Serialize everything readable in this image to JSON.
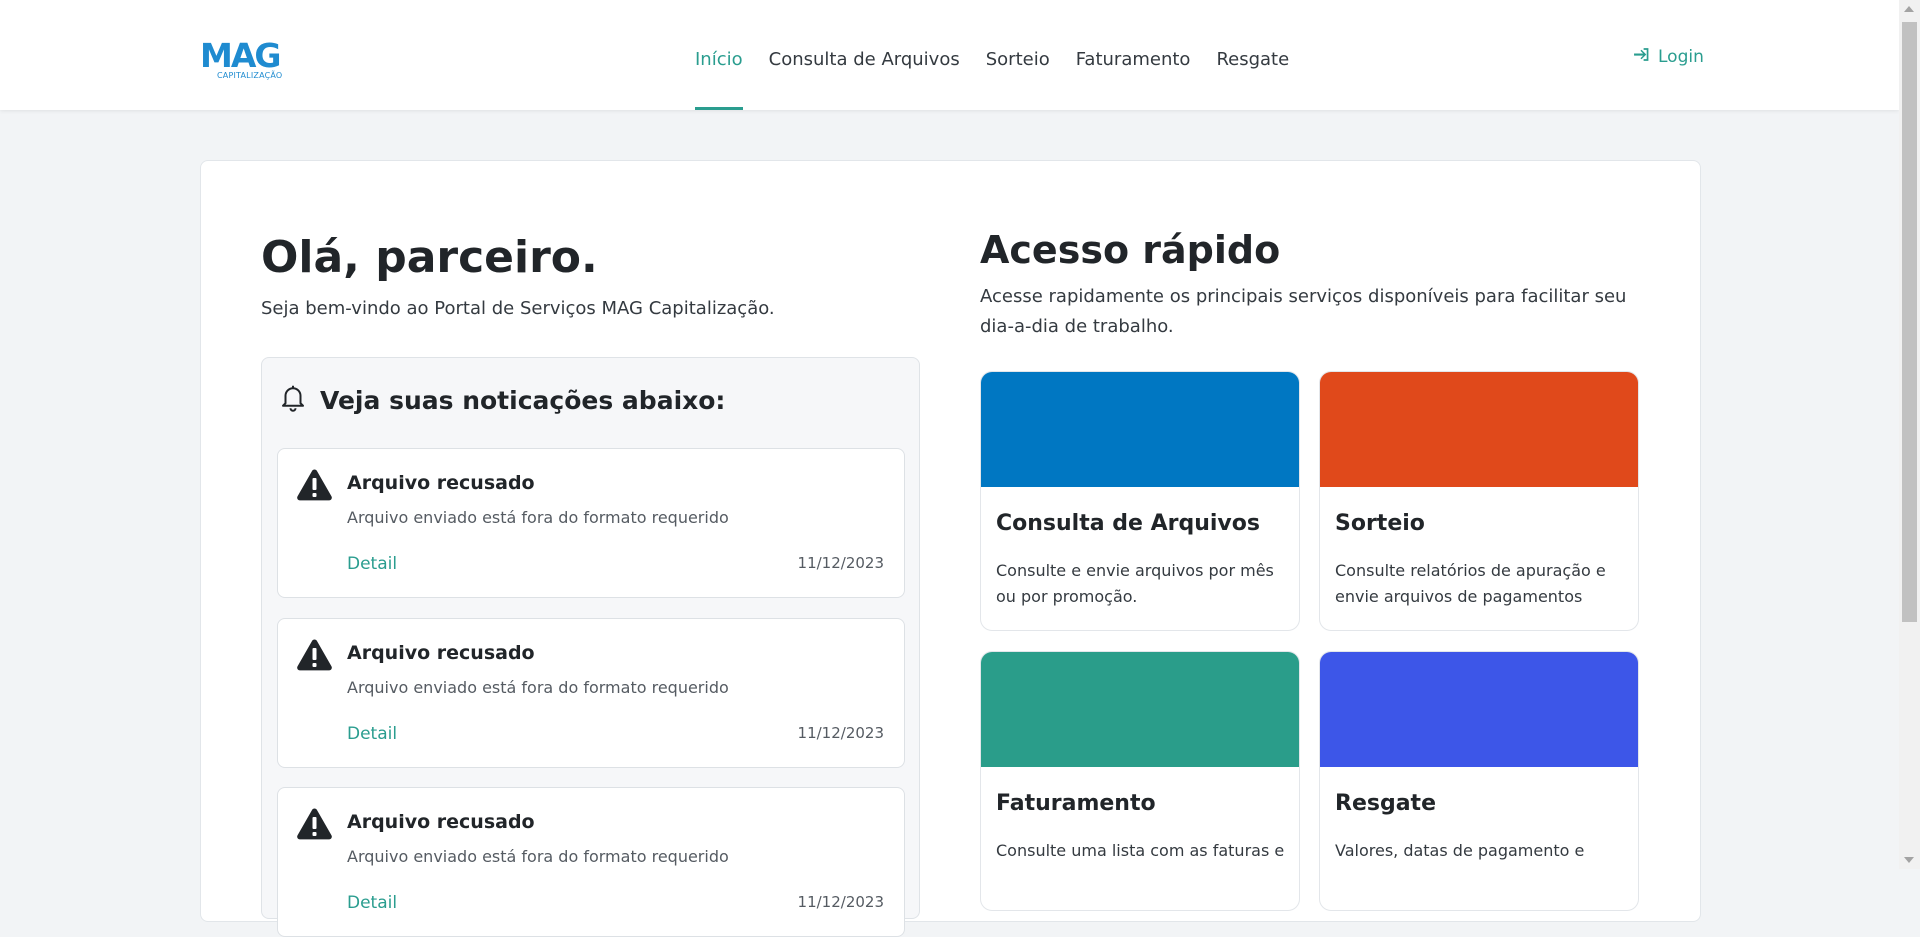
{
  "brand": {
    "name": "MAG",
    "subtitle": "CAPITALIZAÇÃO",
    "color": "#1f8bd0"
  },
  "nav": {
    "items": [
      {
        "label": "Início",
        "active": true
      },
      {
        "label": "Consulta de Arquivos",
        "active": false
      },
      {
        "label": "Sorteio",
        "active": false
      },
      {
        "label": "Faturamento",
        "active": false
      },
      {
        "label": "Resgate",
        "active": false
      }
    ],
    "login_label": "Login",
    "login_icon": "sign-in-icon"
  },
  "colors": {
    "accent": "#2a9d8f"
  },
  "greeting": {
    "title": "Olá, parceiro.",
    "subtitle": "Seja bem-vindo ao Portal de Serviços MAG Capitalização."
  },
  "notifications": {
    "heading": "Veja suas noticações abaixo:",
    "heading_icon": "bell-icon",
    "items": [
      {
        "icon": "warning-icon",
        "title": "Arquivo recusado",
        "description": "Arquivo enviado está fora do formato requerido",
        "link": "Detail",
        "date": "11/12/2023"
      },
      {
        "icon": "warning-icon",
        "title": "Arquivo recusado",
        "description": "Arquivo enviado está fora do formato requerido",
        "link": "Detail",
        "date": "11/12/2023"
      },
      {
        "icon": "warning-icon",
        "title": "Arquivo recusado",
        "description": "Arquivo enviado está fora do formato requerido",
        "link": "Detail",
        "date": "11/12/2023"
      }
    ]
  },
  "quick_access": {
    "title": "Acesso rápido",
    "description": "Acesse rapidamente os principais serviços disponíveis para facilitar seu dia-a-dia de trabalho.",
    "cards": [
      {
        "title": "Consulta de Arquivos",
        "text": "Consulte e envie arquivos por mês ou por promoção.",
        "color": "#0077c2"
      },
      {
        "title": "Sorteio",
        "text": "Consulte relatórios de apuração e envie arquivos de pagamentos",
        "color": "#e0491b"
      },
      {
        "title": "Faturamento",
        "text": "Consulte uma lista com as faturas e",
        "color": "#2a9d8a"
      },
      {
        "title": "Resgate",
        "text": "Valores, datas de pagamento e",
        "color": "#3d56e8"
      }
    ]
  }
}
